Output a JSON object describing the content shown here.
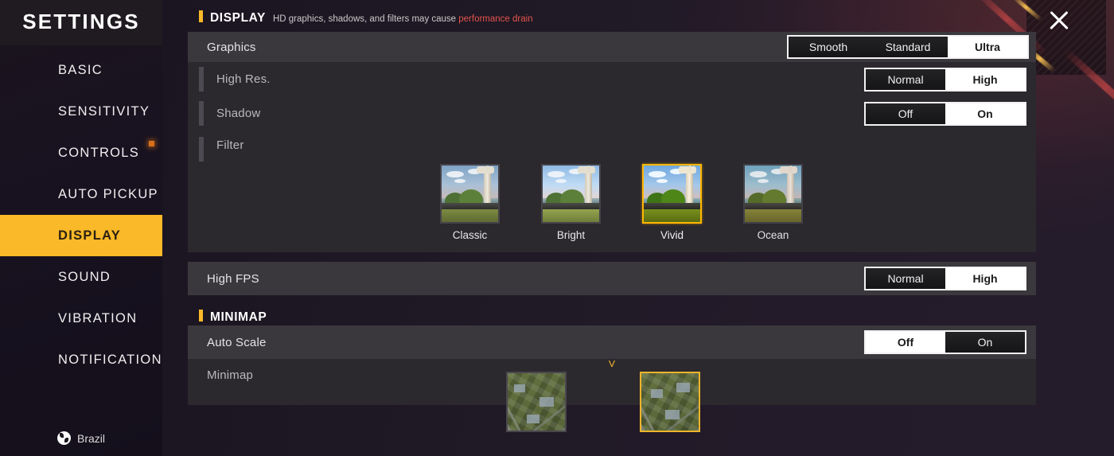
{
  "sidebar": {
    "title": "SETTINGS",
    "items": [
      {
        "label": "BASIC",
        "active": false,
        "dot": false
      },
      {
        "label": "SENSITIVITY",
        "active": false,
        "dot": false
      },
      {
        "label": "CONTROLS",
        "active": false,
        "dot": true
      },
      {
        "label": "AUTO PICKUP",
        "active": false,
        "dot": false
      },
      {
        "label": "DISPLAY",
        "active": true,
        "dot": false
      },
      {
        "label": "SOUND",
        "active": false,
        "dot": false
      },
      {
        "label": "VIBRATION",
        "active": false,
        "dot": false
      },
      {
        "label": "NOTIFICATION",
        "active": false,
        "dot": false
      }
    ],
    "country": "Brazil",
    "country_icon": "globe-icon"
  },
  "window": {
    "close_icon": "close-icon"
  },
  "display_section": {
    "title": "DISPLAY",
    "subtitle_normal": "HD graphics, shadows, and filters may cause ",
    "subtitle_warning": "performance drain",
    "graphics": {
      "label": "Graphics",
      "options": [
        "Smooth",
        "Standard",
        "Ultra"
      ],
      "selected": "Ultra"
    },
    "high_res": {
      "label": "High Res.",
      "options": [
        "Normal",
        "High"
      ],
      "selected": "High"
    },
    "shadow": {
      "label": "Shadow",
      "options": [
        "Off",
        "On"
      ],
      "selected": "On"
    },
    "filter": {
      "label": "Filter",
      "options": [
        "Classic",
        "Bright",
        "Vivid",
        "Ocean"
      ],
      "selected": "Vivid"
    },
    "high_fps": {
      "label": "High FPS",
      "options": [
        "Normal",
        "High"
      ],
      "selected": "High"
    }
  },
  "minimap_section": {
    "title": "MINIMAP",
    "auto_scale": {
      "label": "Auto Scale",
      "options": [
        "Off",
        "On"
      ],
      "selected": "Off"
    },
    "minimap": {
      "label": "Minimap",
      "options": [
        "minimap-style-1",
        "minimap-style-2"
      ],
      "selected_index": 1
    },
    "scroll_indicator_icon": "chevron-down-icon"
  },
  "colors": {
    "accent_gold": "#f9b928",
    "warning_red": "#e4544c",
    "selected_white": "#ffffff",
    "panel": "#262329",
    "row_main": "#3a383d",
    "row_sub": "#2b282e"
  }
}
